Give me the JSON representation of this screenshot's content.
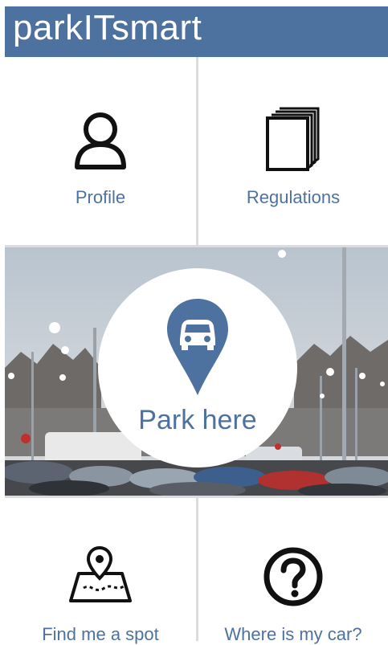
{
  "header": {
    "title": "parkITsmart"
  },
  "tiles": {
    "profile": {
      "label": "Profile",
      "icon": "person-icon"
    },
    "regulations": {
      "label": "Regulations",
      "icon": "book-icon"
    },
    "find_spot": {
      "label": "Find me a spot",
      "icon": "map-pin-icon"
    },
    "where_car": {
      "label": "Where is my car?",
      "icon": "question-icon"
    }
  },
  "park": {
    "label": "Park here",
    "icon": "car-pin-icon",
    "background": "parking-lot-photo"
  },
  "colors": {
    "accent": "#4e72a0",
    "header_bg": "#4e72a0",
    "divider": "#dcdcdc",
    "icon": "#111111"
  }
}
